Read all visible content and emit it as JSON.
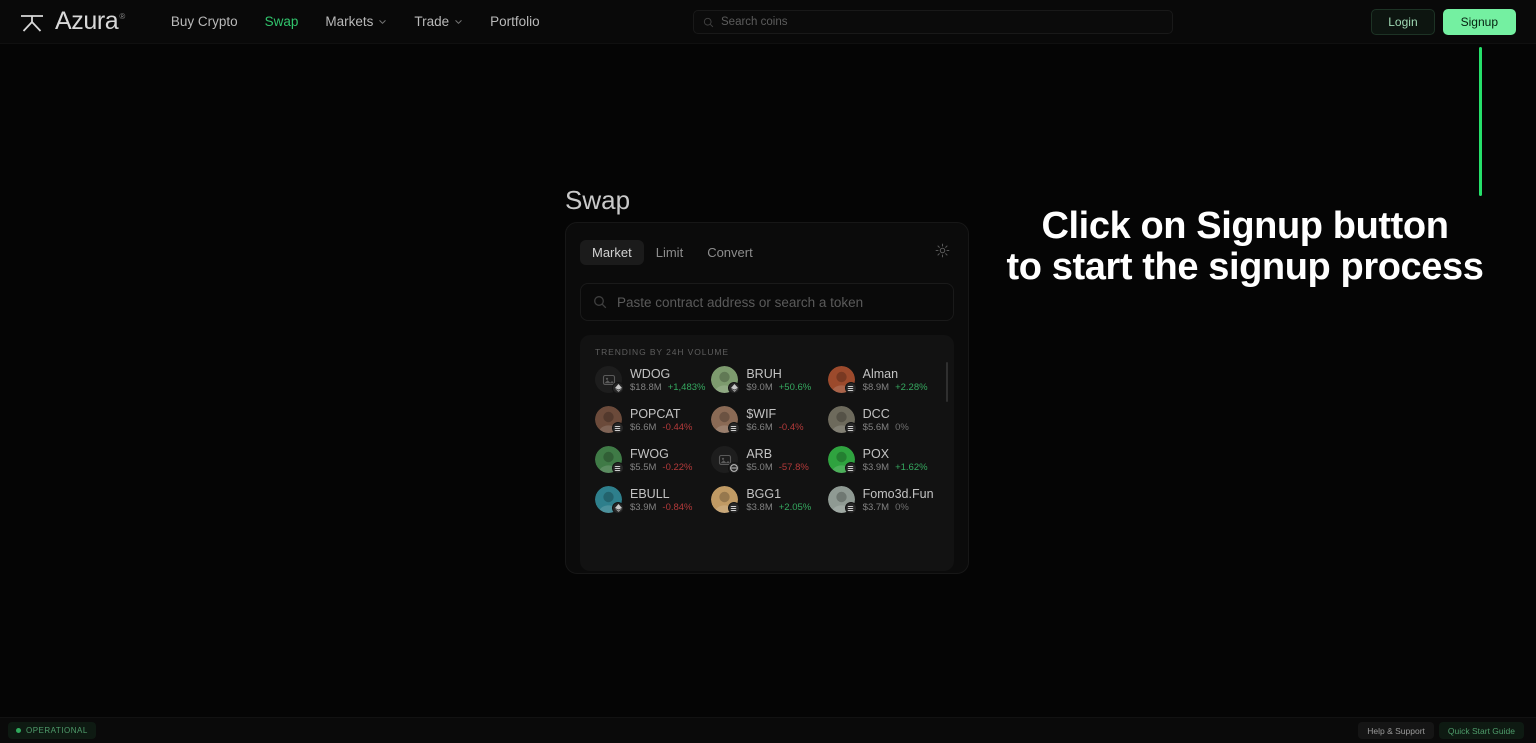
{
  "header": {
    "logo_text": "Azura",
    "logo_mark_icon": "azura-logo-icon",
    "logo_registered": "®",
    "nav": [
      {
        "label": "Buy Crypto",
        "active": false,
        "has_chevron": false
      },
      {
        "label": "Swap",
        "active": true,
        "has_chevron": false
      },
      {
        "label": "Markets",
        "active": false,
        "has_chevron": true
      },
      {
        "label": "Trade",
        "active": false,
        "has_chevron": true
      },
      {
        "label": "Portfolio",
        "active": false,
        "has_chevron": false
      }
    ],
    "search": {
      "placeholder": "Search coins",
      "value": "",
      "icon": "search-icon"
    },
    "login_label": "Login",
    "signup_label": "Signup"
  },
  "swap": {
    "title": "Swap",
    "tabs": [
      {
        "label": "Market",
        "active": true
      },
      {
        "label": "Limit",
        "active": false
      },
      {
        "label": "Convert",
        "active": false
      }
    ],
    "settings_icon": "gear-icon",
    "token_search": {
      "placeholder": "Paste contract address or search a token",
      "value": "",
      "icon": "search-icon"
    },
    "trending_title": "TRENDING BY 24H VOLUME",
    "trending": [
      {
        "symbol": "WDOG",
        "volume": "$18.8M",
        "change": "+1,483%",
        "dir": "up",
        "avatar": "placeholder",
        "avatar_color": "#1d1d1d",
        "chain": "eth"
      },
      {
        "symbol": "BRUH",
        "volume": "$9.0M",
        "change": "+50.6%",
        "dir": "up",
        "avatar": "image",
        "avatar_color": "#7d9b6e",
        "chain": "eth"
      },
      {
        "symbol": "Alman",
        "volume": "$8.9M",
        "change": "+2.28%",
        "dir": "up",
        "avatar": "image",
        "avatar_color": "#9c4a2c",
        "chain": "sol"
      },
      {
        "symbol": "POPCAT",
        "volume": "$6.6M",
        "change": "-0.44%",
        "dir": "down",
        "avatar": "image",
        "avatar_color": "#6b4a3a",
        "chain": "sol"
      },
      {
        "symbol": "$WIF",
        "volume": "$6.6M",
        "change": "-0.4%",
        "dir": "down",
        "avatar": "image",
        "avatar_color": "#8a6a55",
        "chain": "sol"
      },
      {
        "symbol": "DCC",
        "volume": "$5.6M",
        "change": "0%",
        "dir": "flat",
        "avatar": "image",
        "avatar_color": "#6d6a5c",
        "chain": "sol"
      },
      {
        "symbol": "FWOG",
        "volume": "$5.5M",
        "change": "-0.22%",
        "dir": "down",
        "avatar": "image",
        "avatar_color": "#3f7a46",
        "chain": "sol"
      },
      {
        "symbol": "ARB",
        "volume": "$5.0M",
        "change": "-57.8%",
        "dir": "down",
        "avatar": "placeholder",
        "avatar_color": "#1d1d1d",
        "chain": "base"
      },
      {
        "symbol": "POX",
        "volume": "$3.9M",
        "change": "+1.62%",
        "dir": "up",
        "avatar": "image",
        "avatar_color": "#2fa33f",
        "chain": "sol"
      },
      {
        "symbol": "EBULL",
        "volume": "$3.9M",
        "change": "-0.84%",
        "dir": "down",
        "avatar": "image",
        "avatar_color": "#2e7f8c",
        "chain": "eth"
      },
      {
        "symbol": "BGG1",
        "volume": "$3.8M",
        "change": "+2.05%",
        "dir": "up",
        "avatar": "image",
        "avatar_color": "#c09a64",
        "chain": "sol"
      },
      {
        "symbol": "Fomo3d.Fun",
        "volume": "$3.7M",
        "change": "0%",
        "dir": "flat",
        "avatar": "image",
        "avatar_color": "#8f9a93",
        "chain": "sol"
      }
    ]
  },
  "annotation": {
    "line1": "Click on Signup button",
    "line2": "to start the signup process",
    "pointer_color": "#25e06a"
  },
  "footer": {
    "status": "OPERATIONAL",
    "help_label": "Help & Support",
    "guide_label": "Quick Start Guide"
  }
}
